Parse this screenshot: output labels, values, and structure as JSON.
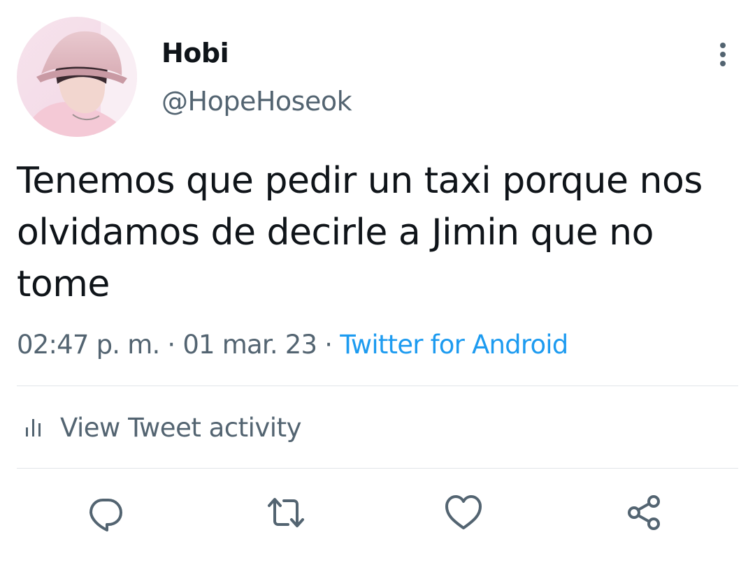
{
  "author": {
    "display_name": "Hobi",
    "handle": "@HopeHoseok",
    "avatar_icon": "profile-photo"
  },
  "menu": {
    "icon": "more-vertical-icon"
  },
  "tweet": {
    "text": "Tenemos que pedir un taxi porque nos olvidamos de decirle a Jimin que no tome",
    "time": "02:47 p. m.",
    "date": "01 mar. 23",
    "separator": "·",
    "source": "Twitter for Android"
  },
  "activity": {
    "label": "View Tweet activity",
    "icon": "bar-chart-icon"
  },
  "actions": [
    {
      "name": "reply",
      "icon": "reply-icon"
    },
    {
      "name": "retweet",
      "icon": "retweet-icon"
    },
    {
      "name": "like",
      "icon": "heart-icon"
    },
    {
      "name": "share",
      "icon": "share-icon"
    }
  ],
  "colors": {
    "text": "#0f1419",
    "secondary": "#536471",
    "link": "#1d9bf0",
    "divider": "#e1e5e8"
  }
}
